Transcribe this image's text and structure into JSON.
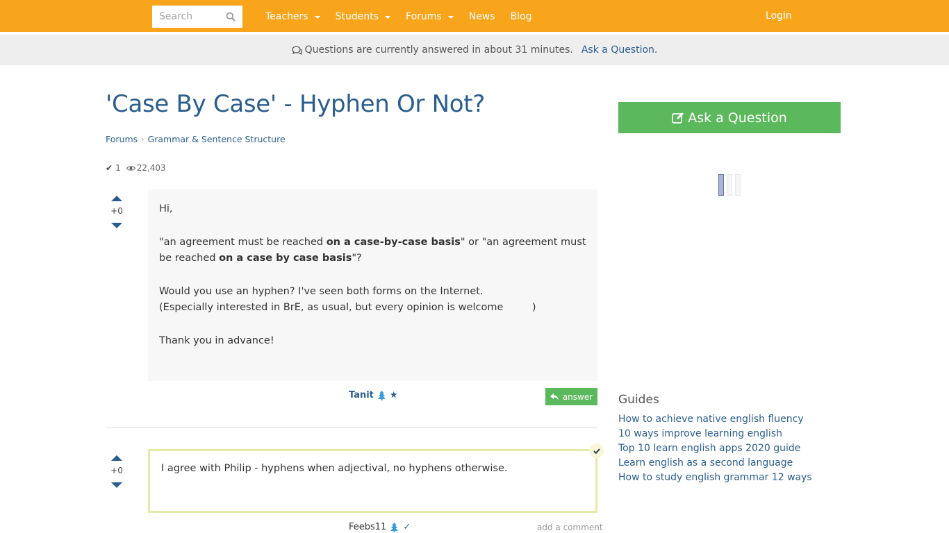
{
  "navbar": {
    "search_placeholder": "Search",
    "items": [
      {
        "label": "Teachers",
        "dropdown": true
      },
      {
        "label": "Students",
        "dropdown": true
      },
      {
        "label": "Forums",
        "dropdown": true
      },
      {
        "label": "News",
        "dropdown": false
      },
      {
        "label": "Blog",
        "dropdown": false
      }
    ],
    "login_label": "Login"
  },
  "infobar": {
    "text": "Questions are currently answered in about 31 minutes.",
    "link_label": "Ask a Question."
  },
  "question": {
    "title": "'Case By Case' - Hyphen Or Not?",
    "breadcrumb": [
      "Forums",
      "Grammar & Sentence Structure"
    ],
    "answers_count": "1",
    "views": "22,403",
    "votes": "+0",
    "body": {
      "greeting": "Hi,",
      "p2_a": "\"an agreement must be reached ",
      "p2_b": "on a case-by-case basis",
      "p2_c": "\" or \"an agreement must be reached ",
      "p2_d": "on a case by case basis",
      "p2_e": "\"?",
      "p3_line1": "Would you use an hyphen? I've seen both forms on the Internet.",
      "p3_line2": "(Especially interested in BrE, as usual, but every opinion is welcome         )",
      "closing": "Thank you in advance!"
    },
    "author": "Tanit",
    "answer_button_label": "answer"
  },
  "answer": {
    "votes": "+0",
    "body": "I agree with Philip - hyphens when adjectival, no hyphens otherwise.",
    "author": "Feebs11",
    "accepted": true,
    "add_comment_label": "add a comment"
  },
  "sidebar": {
    "ask_button_label": "Ask a Question",
    "guides_title": "Guides",
    "guides": [
      "How to achieve native english fluency",
      "10 ways improve learning english",
      "Top 10 learn english apps 2020 guide",
      "Learn english as a second language",
      "How to study english grammar 12 ways"
    ]
  },
  "colors": {
    "brand_orange": "#f8a51c",
    "link_blue": "#2a5d8f",
    "success_green": "#5cb85c",
    "accepted_border": "#e5eaa8"
  }
}
